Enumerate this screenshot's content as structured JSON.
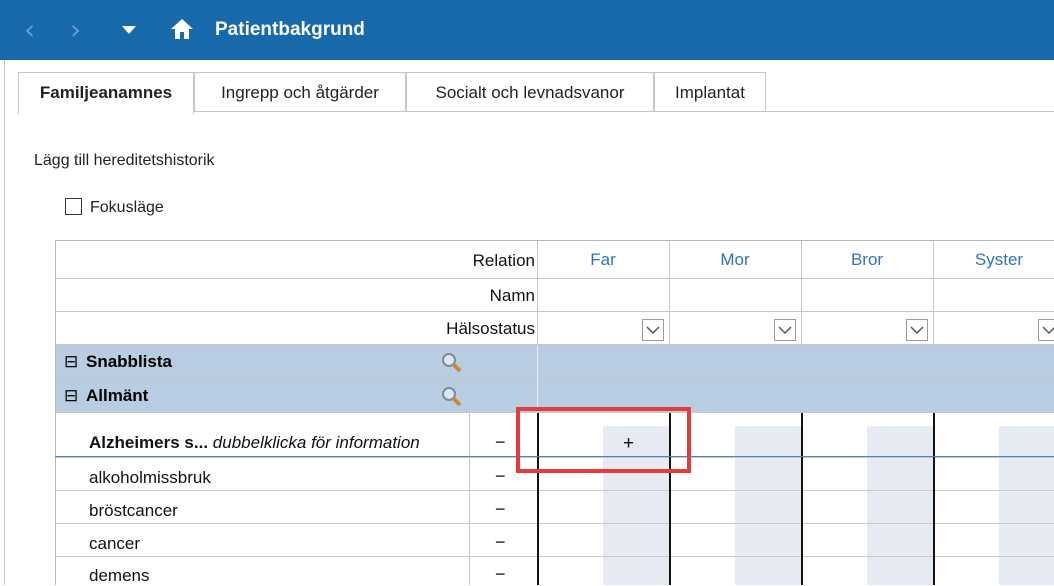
{
  "titlebar": {
    "title": "Patientbakgrund",
    "back": "‹",
    "forward": "›",
    "home_icon": "home-icon"
  },
  "tabs": [
    {
      "label": "Familjeanamnes",
      "active": true
    },
    {
      "label": "Ingrepp och åtgärder",
      "active": false
    },
    {
      "label": "Socialt och levnadsvanor",
      "active": false
    },
    {
      "label": "Implantat",
      "active": false
    }
  ],
  "content": {
    "add_heredity": "Lägg till hereditetshistorik",
    "focus_mode": "Fokusläge"
  },
  "grid": {
    "header_rows": [
      "Relation",
      "Namn",
      "Hälsostatus"
    ],
    "relations": [
      "Far",
      "Mor",
      "Bror",
      "Syster"
    ],
    "sections": [
      "Snabblista",
      "Allmänt"
    ],
    "conditions": [
      {
        "name": "Alzheimers s...",
        "hint": "dubbelklicka för information",
        "value": "−",
        "far": "+"
      },
      {
        "name": "alkoholmissbruk",
        "value": "−"
      },
      {
        "name": "bröstcancer",
        "value": "−"
      },
      {
        "name": "cancer",
        "value": "−"
      },
      {
        "name": "demens",
        "value": "−"
      }
    ],
    "collapse_symbol": "⊟"
  },
  "colors": {
    "titlebar": "#1769aa",
    "section_bg": "#b8cde1",
    "relation_text": "#2e73c2",
    "highlight": "#e43b3b"
  }
}
